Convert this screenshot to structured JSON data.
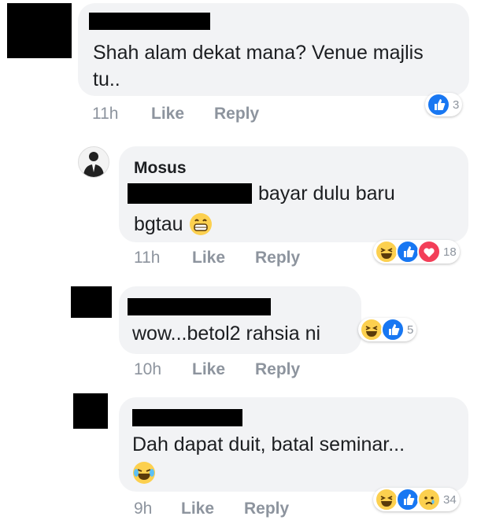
{
  "comments": [
    {
      "name": "",
      "text_lines": [
        "Shah alam dekat mana? Venue majlis",
        "tu.."
      ],
      "time": "11h",
      "like": "Like",
      "reply": "Reply",
      "reaction_count": "3",
      "reactions": [
        "like"
      ]
    },
    {
      "name": "Mosus",
      "text_line1": "bayar dulu baru",
      "text_line2": "bgtau",
      "time": "11h",
      "like": "Like",
      "reply": "Reply",
      "reaction_count": "18",
      "reactions": [
        "haha",
        "like",
        "love"
      ]
    },
    {
      "name": "",
      "text": "wow...betol2 rahsia ni",
      "time": "10h",
      "like": "Like",
      "reply": "Reply",
      "reaction_count": "5",
      "reactions": [
        "haha",
        "like"
      ]
    },
    {
      "name": "",
      "text": "Dah dapat duit, batal seminar...",
      "time": "9h",
      "like": "Like",
      "reply": "Reply",
      "reaction_count": "34",
      "reactions": [
        "haha",
        "like",
        "sad"
      ]
    }
  ]
}
